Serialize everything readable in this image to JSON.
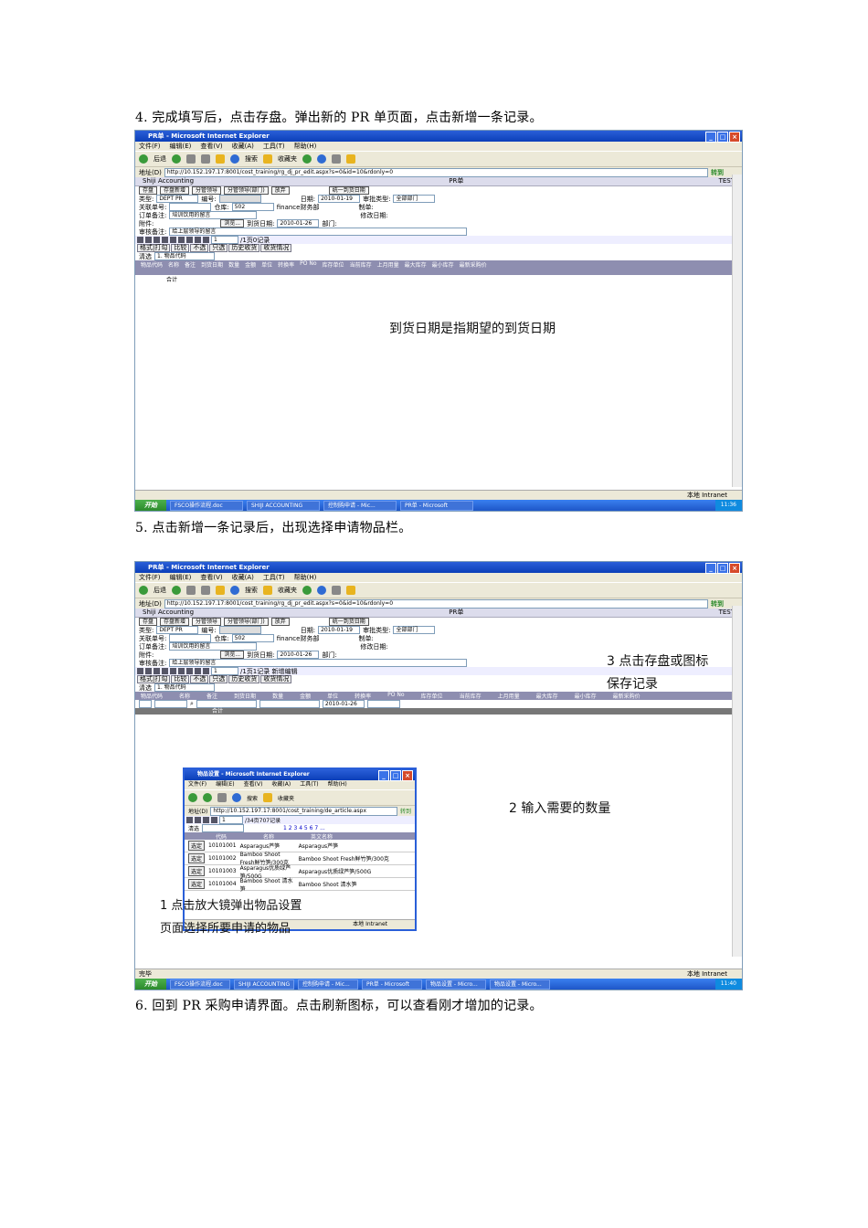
{
  "steps": {
    "s4": "4. 完成填写后，点击存盘。弹出新的 PR 单页面，点击新增一条记录。",
    "s5": "5. 点击新增一条记录后，出现选择申请物品栏。",
    "s6": "6. 回到 PR 采购申请界面。点击刷新图标，可以查看刚才增加的记录。"
  },
  "annotations": {
    "a1": "到货日期是指期望的到货日期",
    "a3_line1": "3  点击存盘或图标",
    "a3_line2": "保存记录",
    "a2": "2 输入需要的数量",
    "a1b_line1": "1 点击放大镜弹出物品设置",
    "a1b_line2": "页面选择所要申请的物品"
  },
  "browser": {
    "title": "PR单 - Microsoft Internet Explorer",
    "menu": [
      "文件(F)",
      "编辑(E)",
      "查看(V)",
      "收藏(A)",
      "工具(T)",
      "帮助(H)"
    ],
    "back_label": "后退",
    "search_label": "搜索",
    "favorites_label": "收藏夹",
    "address_label": "地址(D)",
    "address": "http://10.152.197.17:8001/cost_training/rg_dj_pr_edit.aspx?s=0&id=10&rdonly=0",
    "go_label": "转到",
    "status_right": "本地 Intranet",
    "status_left": "完毕"
  },
  "app": {
    "company": "Shiji Accounting",
    "doc": "PR单",
    "env": "TEST",
    "buttons": [
      "存盘",
      "存盘新增",
      "分管领导",
      "分管领导(部门)",
      "放弃",
      "统一到货日期"
    ],
    "type_label": "类型:",
    "type_value": "DEPT PR",
    "no_label": "编号:",
    "date_label": "日期:",
    "date_value": "2010-01-19",
    "approve_type_label": "审批类型:",
    "approve_type_value": "全部部门",
    "related_label": "关联单号:",
    "warehouse_label": "仓库:",
    "warehouse_value": "502",
    "dept_value": "finance财务部",
    "maker_label": "制单:",
    "order_note_label": "订单备注:",
    "order_note_value": "培训饮用的留言",
    "modify_date_label": "修改日期:",
    "attach_label": "附件:",
    "browse_label": "浏览...",
    "arrive_label": "到货日期:",
    "arrive_value": "2010-01-26",
    "dept_label": "部门:",
    "audit_note_label": "审核备注:",
    "audit_note_value": "给上层领导的留言",
    "nav_page": "1",
    "nav_text1": "/1页0记录",
    "nav_text2": "/1页1记录  新增编辑",
    "tabs": [
      "格式|打勾",
      "比较",
      "不选",
      "只选",
      "历史收货",
      "收货情况"
    ],
    "filter_label": "清选",
    "filter_field": "1. 物品代码",
    "grid_cols": [
      "物品代码",
      "名称",
      "备注",
      "到货日期",
      "数量",
      "金额",
      "单位",
      "转换率",
      "PO No",
      "库存单位",
      "当前库存",
      "上月用量",
      "最大库存",
      "最小库存",
      "最新采购价"
    ],
    "grid_row_date": "2010-01-26",
    "grid_total": "合计"
  },
  "popup": {
    "title": "物品设置 - Microsoft Internet Explorer",
    "address": "http://10.152.197.17:8001/cost_training/de_article.aspx",
    "nav_text": "/34页707记录",
    "pages": "1 2 3 4 5 6 7 ...",
    "cols": [
      "代码",
      "名称",
      "英文名称"
    ],
    "select_label": "选定",
    "rows": [
      {
        "code": "10101001",
        "name": "Asparagus芦笋",
        "en": "Asparagus芦笋"
      },
      {
        "code": "10101002",
        "name": "Bamboo Shoot Fresh鲜竹笋/300克",
        "en": "Bamboo Shoot Fresh鲜竹笋/300克"
      },
      {
        "code": "10101003",
        "name": "Asparagus优质绿芦笋/500G",
        "en": "Asparagus优质绿芦笋/500G"
      },
      {
        "code": "10101004",
        "name": "Bamboo Shoot 清水笋",
        "en": "Bamboo Shoot 清水笋"
      }
    ],
    "status": "本地 Intranet"
  },
  "taskbar": {
    "start": "开始",
    "tasks1": [
      "FSCO操作流程.doc",
      "SHIJI ACCOUNTING",
      "控制购申请 - Mic...",
      "PR单 - Microsoft"
    ],
    "tasks2": [
      "FSCO操作流程.doc",
      "SHIJI ACCOUNTING",
      "控制购申请 - Mic...",
      "PR单 - Microsoft",
      "物品设置 - Micro...",
      "物品设置 - Micro..."
    ],
    "time1": "11:36",
    "time2": "11:40"
  }
}
